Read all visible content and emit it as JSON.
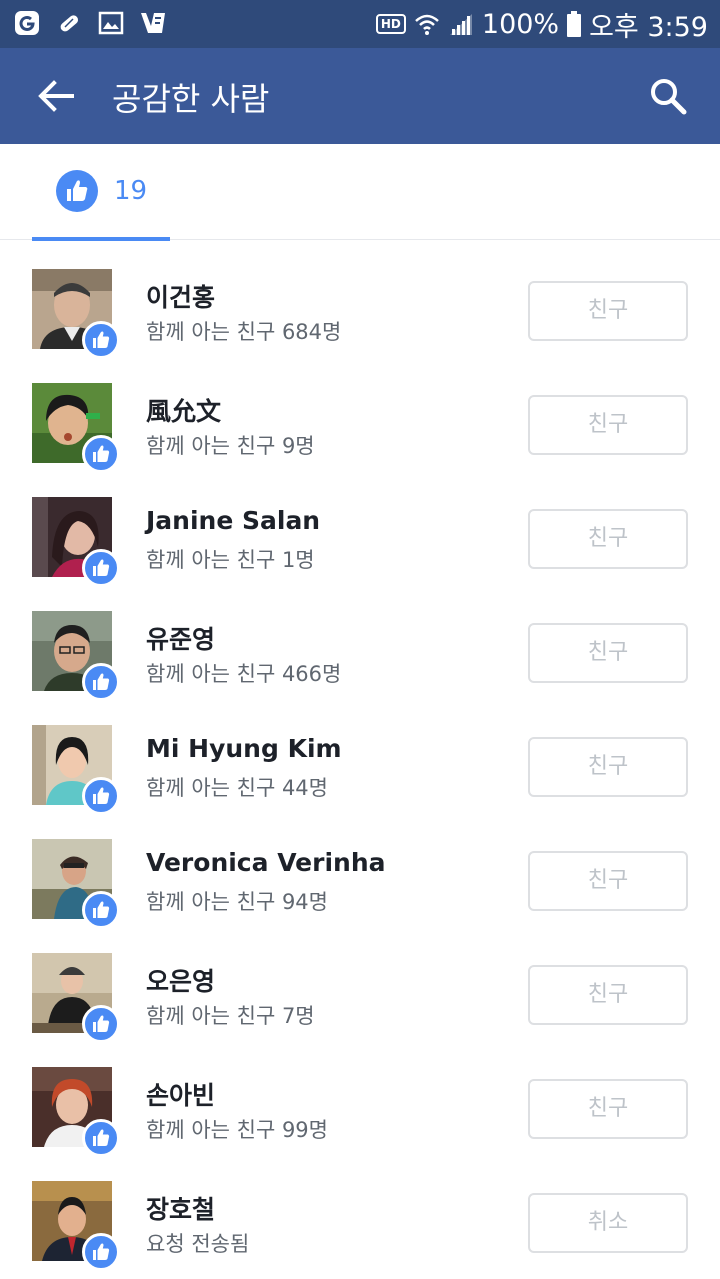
{
  "status_bar": {
    "left_icons": [
      "g-app-icon",
      "pill-icon",
      "image-icon",
      "v3-app-icon"
    ],
    "hd_label": "HD",
    "battery": "100%",
    "time": "오후 3:59"
  },
  "app_bar": {
    "title": "공감한 사람",
    "back_icon": "arrow-left-icon",
    "search_icon": "search-icon"
  },
  "tabs": {
    "like_count": "19"
  },
  "people": [
    {
      "name": "이건홍",
      "subtitle": "함께 아는 친구 684명",
      "action": "친구"
    },
    {
      "name": "風允文",
      "subtitle": "함께 아는 친구 9명",
      "action": "친구"
    },
    {
      "name": "Janine Salan",
      "subtitle": "함께 아는 친구 1명",
      "action": "친구"
    },
    {
      "name": "유준영",
      "subtitle": "함께 아는 친구 466명",
      "action": "친구"
    },
    {
      "name": "Mi Hyung Kim",
      "subtitle": "함께 아는 친구 44명",
      "action": "친구"
    },
    {
      "name": "Veronica Verinha",
      "subtitle": "함께 아는 친구 94명",
      "action": "친구"
    },
    {
      "name": "오은영",
      "subtitle": "함께 아는 친구 7명",
      "action": "친구"
    },
    {
      "name": "손아빈",
      "subtitle": "함께 아는 친구 99명",
      "action": "친구"
    },
    {
      "name": "장호철",
      "subtitle": "요청 전송됨",
      "action": "취소"
    }
  ],
  "colors": {
    "status_bar": "#2f4a7a",
    "app_bar": "#3b5998",
    "accent": "#4a8af4",
    "name_text": "#1d2129",
    "sub_text": "#606770",
    "button_text": "#bec3c9"
  }
}
